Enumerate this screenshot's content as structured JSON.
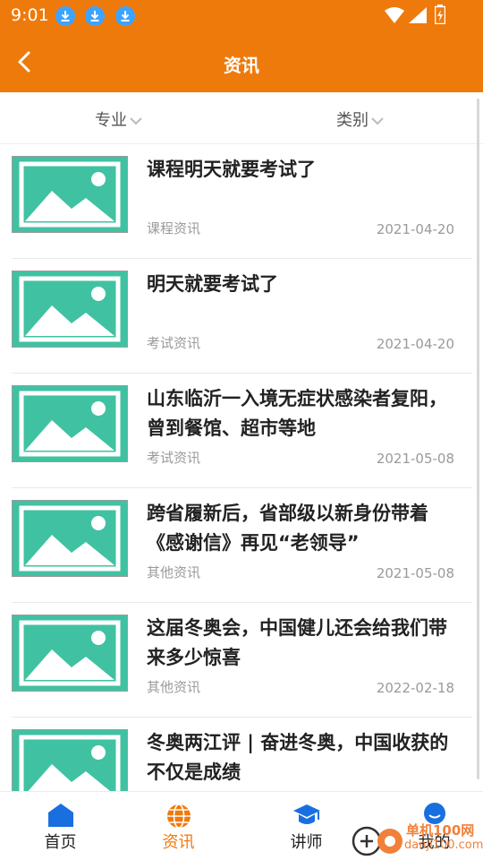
{
  "status_bar": {
    "time": "9:01"
  },
  "header": {
    "title": "资讯"
  },
  "filters": {
    "major": "专业",
    "category": "类别"
  },
  "articles": [
    {
      "title": "课程明天就要考试了",
      "category": "课程资讯",
      "date": "2021-04-20"
    },
    {
      "title": "明天就要考试了",
      "category": "考试资讯",
      "date": "2021-04-20"
    },
    {
      "title": "山东临沂一入境无症状感染者复阳，曾到餐馆、超市等地",
      "category": "考试资讯",
      "date": "2021-05-08"
    },
    {
      "title": "跨省履新后，省部级以新身份带着《感谢信》再见“老领导”",
      "category": "其他资讯",
      "date": "2021-05-08"
    },
    {
      "title": "这届冬奥会，中国健儿还会给我们带来多少惊喜",
      "category": "其他资讯",
      "date": "2022-02-18"
    },
    {
      "title": "冬奥两江评 | 奋进冬奥，中国收获的不仅是成绩",
      "category": "",
      "date": ""
    }
  ],
  "tabs": [
    {
      "label": "首页",
      "icon": "home-icon"
    },
    {
      "label": "资讯",
      "icon": "globe-icon",
      "active": true
    },
    {
      "label": "讲师",
      "icon": "graduation-cap-icon"
    },
    {
      "label": "我的",
      "icon": "user-icon"
    }
  ],
  "watermark": {
    "text": "单机100网",
    "url": "danji100.com"
  },
  "colors": {
    "accent": "#ee7a0c",
    "thumb": "#40c2a2",
    "tab_blue": "#1a6fe0"
  }
}
